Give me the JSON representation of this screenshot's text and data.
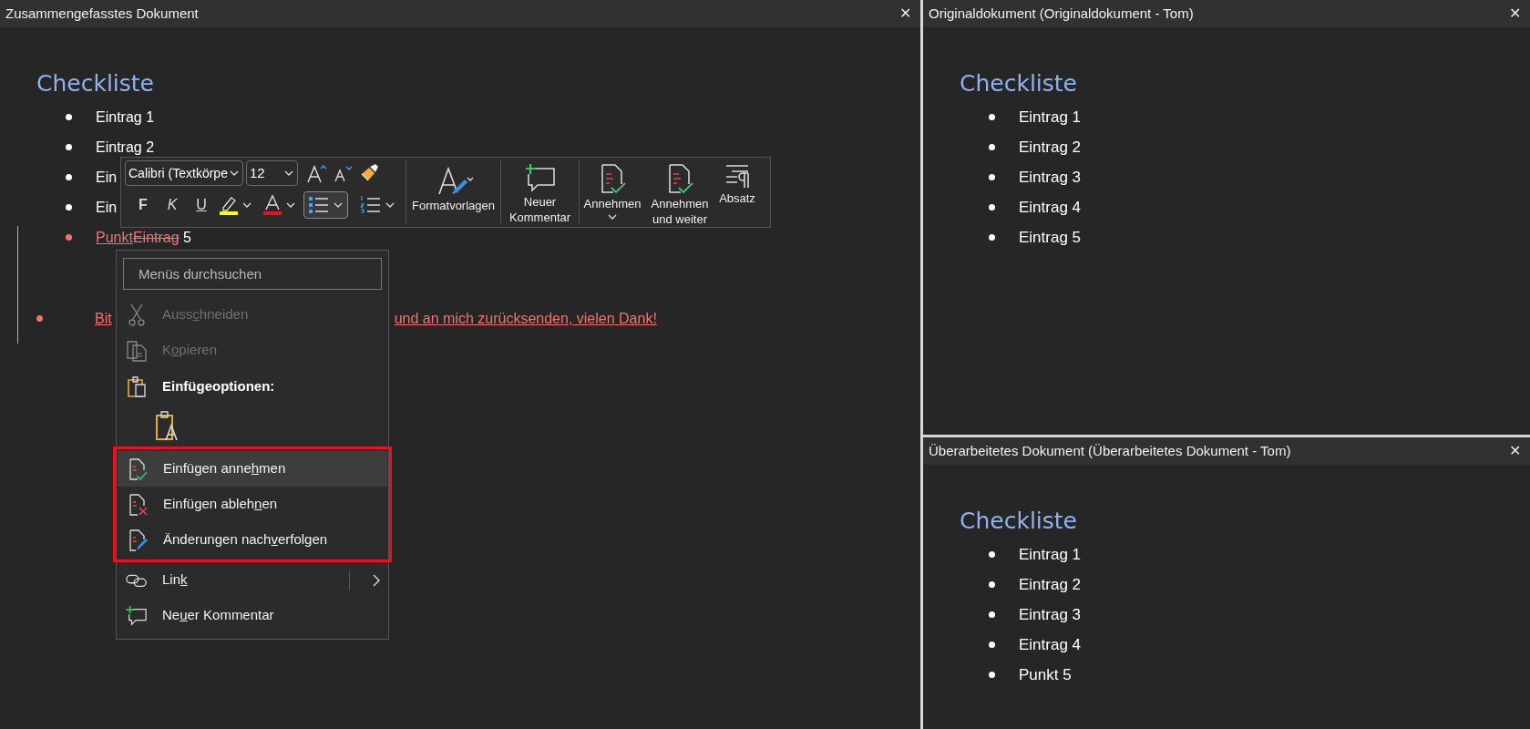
{
  "merged_pane": {
    "title": "Zusammengefasstes Dokument",
    "close": "✕",
    "heading": "Checkliste",
    "items": [
      {
        "changed": false,
        "segments": [
          {
            "kind": "normal",
            "text": "Eintrag 1"
          }
        ]
      },
      {
        "changed": false,
        "segments": [
          {
            "kind": "normal",
            "text": "Eintrag 2"
          }
        ]
      },
      {
        "changed": false,
        "segments": [
          {
            "kind": "normal",
            "text": "Ein"
          }
        ]
      },
      {
        "changed": false,
        "segments": [
          {
            "kind": "normal",
            "text": "Ein"
          }
        ]
      },
      {
        "changed": true,
        "segments": [
          {
            "kind": "inserted",
            "text": "Punkt"
          },
          {
            "kind": "deleted",
            "text": "Eintrag"
          },
          {
            "kind": "normal",
            "text": " 5"
          }
        ]
      }
    ],
    "paragraph": {
      "changed": true,
      "segments": [
        {
          "kind": "inserted",
          "text": "Bit"
        },
        {
          "kind": "inserted",
          "text": "und an mich zurücksenden, vielen Dank!"
        }
      ]
    }
  },
  "original_pane": {
    "title": "Originaldokument (Originaldokument - Tom)",
    "close": "✕",
    "heading": "Checkliste",
    "items": [
      "Eintrag 1",
      "Eintrag 2",
      "Eintrag 3",
      "Eintrag 4",
      "Eintrag 5"
    ]
  },
  "revised_pane": {
    "title": "Überarbeitetes Dokument (Überarbeitetes Dokument - Tom)",
    "close": "✕",
    "heading": "Checkliste",
    "items": [
      "Eintrag 1",
      "Eintrag 2",
      "Eintrag 3",
      "Eintrag 4",
      "Punkt 5"
    ]
  },
  "mini_toolbar": {
    "font_name": "Calibri (Textkörpe",
    "font_size": "12",
    "format_buttons": [
      "F",
      "K",
      "U"
    ],
    "list_buttons": [
      {
        "selected": true
      },
      {
        "selected": false
      }
    ],
    "big_buttons": [
      {
        "label": "Formatvorlagen",
        "dropdown": false
      },
      {
        "label": "Neuer Kommentar",
        "dropdown": false
      },
      {
        "label": "Annehmen",
        "dropdown": true
      },
      {
        "label": "Annehmen und weiter",
        "dropdown": false
      },
      {
        "label": "Absatz",
        "dropdown": false
      }
    ]
  },
  "context_menu": {
    "search": {
      "placeholder": "Menüs durchsuchen"
    },
    "items": [
      {
        "kind": "item",
        "label_parts": [
          "Auss",
          "c",
          "hneiden"
        ],
        "disabled": true,
        "selected": false,
        "submenu": false
      },
      {
        "kind": "item",
        "label_parts": [
          "K",
          "o",
          "pieren"
        ],
        "disabled": true,
        "selected": false,
        "submenu": false
      },
      {
        "kind": "heading",
        "label": "Einfügeoptionen:"
      },
      {
        "kind": "paste_option"
      }
    ],
    "marked_items": [
      {
        "kind": "item",
        "label_parts": [
          "Einfügen anne",
          "h",
          "men"
        ],
        "disabled": false,
        "selected": true,
        "submenu": false
      },
      {
        "kind": "item",
        "label_parts": [
          "Einfügen ableh",
          "n",
          "en"
        ],
        "disabled": false,
        "selected": false,
        "submenu": false
      },
      {
        "kind": "item",
        "label_parts": [
          "Änderungen nach",
          "v",
          "erfolgen"
        ],
        "disabled": false,
        "selected": false,
        "submenu": false
      }
    ],
    "more_items": [
      {
        "kind": "item",
        "label_parts": [
          "Lin",
          "k"
        ],
        "disabled": false,
        "selected": false,
        "submenu": true
      },
      {
        "kind": "item",
        "label_parts": [
          "Ne",
          "u",
          "er Kommentar"
        ],
        "disabled": false,
        "selected": false,
        "submenu": false
      }
    ]
  }
}
